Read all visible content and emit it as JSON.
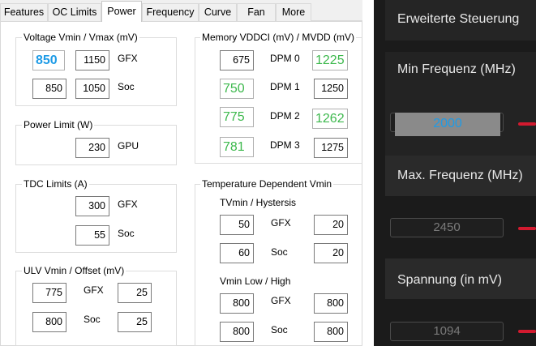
{
  "tabs": {
    "features": "Features",
    "oc_limits": "OC Limits",
    "power": "Power",
    "frequency": "Frequency",
    "curve": "Curve",
    "fan": "Fan",
    "more": "More"
  },
  "voltage": {
    "title": "Voltage Vmin / Vmax (mV)",
    "gfx_label": "GFX",
    "soc_label": "Soc",
    "gfx_min": "850",
    "gfx_max": "1150",
    "soc_min": "850",
    "soc_max": "1050"
  },
  "power_limit": {
    "title": "Power Limit (W)",
    "label": "GPU",
    "value": "230"
  },
  "tdc": {
    "title": "TDC Limits (A)",
    "gfx_label": "GFX",
    "soc_label": "Soc",
    "gfx": "300",
    "soc": "55"
  },
  "ulv": {
    "title": "ULV Vmin / Offset (mV)",
    "gfx_label": "GFX",
    "soc_label": "Soc",
    "gfx_vmin": "775",
    "gfx_offset": "25",
    "soc_vmin": "800",
    "soc_offset": "25"
  },
  "memory": {
    "title": "Memory VDDCI (mV) / MVDD (mV)",
    "dpm": [
      {
        "label": "DPM 0",
        "vddci": "675",
        "mvdd": "1225"
      },
      {
        "label": "DPM 1",
        "vddci": "750",
        "mvdd": "1250"
      },
      {
        "label": "DPM 2",
        "vddci": "775",
        "mvdd": "1262"
      },
      {
        "label": "DPM 3",
        "vddci": "781",
        "mvdd": "1275"
      }
    ]
  },
  "temp_vmin": {
    "title": "Temperature Dependent Vmin",
    "tvmin_title": "TVmin / Hystersis",
    "gfx_label": "GFX",
    "soc_label": "Soc",
    "tvmin_gfx": "50",
    "tvmin_gfx_hyst": "20",
    "tvmin_soc": "60",
    "tvmin_soc_hyst": "20",
    "vmin_title": "Vmin Low / High",
    "vmin_gfx_low": "800",
    "vmin_gfx_high": "800",
    "vmin_soc_low": "800",
    "vmin_soc_high": "800"
  },
  "right_panel": {
    "advanced_control": "Erweiterte Steuerung",
    "min_freq_label": "Min Frequenz (MHz)",
    "min_freq_value": "2000",
    "max_freq_label": "Max. Frequenz (MHz)",
    "max_freq_value": "2450",
    "voltage_label": "Spannung (in mV)",
    "voltage_value": "1094",
    "accent_color": "#d21a2f"
  }
}
